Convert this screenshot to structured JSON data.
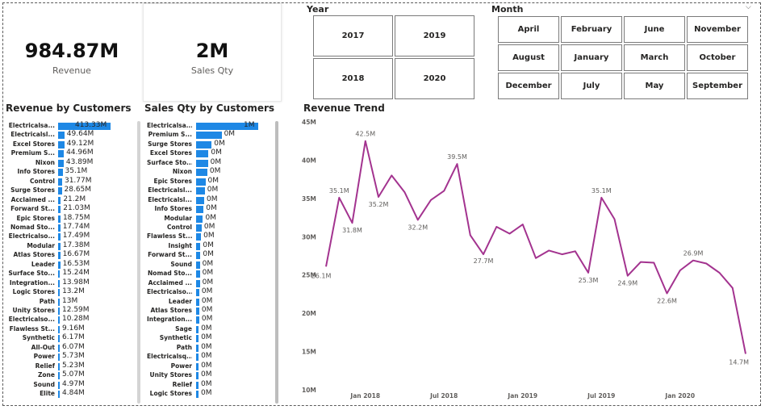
{
  "kpis": {
    "revenue": {
      "value": "984.87M",
      "label": "Revenue"
    },
    "sales_qty": {
      "value": "2M",
      "label": "Sales Qty"
    }
  },
  "year_slicer": {
    "title": "Year",
    "options": [
      "2017",
      "2019",
      "2018",
      "2020"
    ]
  },
  "month_slicer": {
    "title": "Month",
    "options": [
      "April",
      "February",
      "June",
      "November",
      "August",
      "January",
      "March",
      "October",
      "December",
      "July",
      "May",
      "September"
    ]
  },
  "revenue_by_customers": {
    "title": "Revenue by Customers",
    "rows": [
      {
        "name": "Electricalsa...",
        "value": 413.33,
        "label": "413.33M"
      },
      {
        "name": "Electricalsl...",
        "value": 49.64,
        "label": "49.64M"
      },
      {
        "name": "Excel Stores",
        "value": 49.12,
        "label": "49.12M"
      },
      {
        "name": "Premium S...",
        "value": 44.96,
        "label": "44.96M"
      },
      {
        "name": "Nixon",
        "value": 43.89,
        "label": "43.89M"
      },
      {
        "name": "Info Stores",
        "value": 35.1,
        "label": "35.1M"
      },
      {
        "name": "Control",
        "value": 31.77,
        "label": "31.77M"
      },
      {
        "name": "Surge Stores",
        "value": 28.65,
        "label": "28.65M"
      },
      {
        "name": "Acclaimed ...",
        "value": 21.2,
        "label": "21.2M"
      },
      {
        "name": "Forward St...",
        "value": 21.03,
        "label": "21.03M"
      },
      {
        "name": "Epic Stores",
        "value": 18.75,
        "label": "18.75M"
      },
      {
        "name": "Nomad Sto...",
        "value": 17.74,
        "label": "17.74M"
      },
      {
        "name": "Electricalso...",
        "value": 17.49,
        "label": "17.49M"
      },
      {
        "name": "Modular",
        "value": 17.38,
        "label": "17.38M"
      },
      {
        "name": "Atlas Stores",
        "value": 16.67,
        "label": "16.67M"
      },
      {
        "name": "Leader",
        "value": 16.53,
        "label": "16.53M"
      },
      {
        "name": "Surface Sto...",
        "value": 15.24,
        "label": "15.24M"
      },
      {
        "name": "Integration...",
        "value": 13.98,
        "label": "13.98M"
      },
      {
        "name": "Logic Stores",
        "value": 13.2,
        "label": "13.2M"
      },
      {
        "name": "Path",
        "value": 13.0,
        "label": "13M"
      },
      {
        "name": "Unity Stores",
        "value": 12.59,
        "label": "12.59M"
      },
      {
        "name": "Electricalso...",
        "value": 10.28,
        "label": "10.28M"
      },
      {
        "name": "Flawless St...",
        "value": 9.16,
        "label": "9.16M"
      },
      {
        "name": "Synthetic",
        "value": 6.17,
        "label": "6.17M"
      },
      {
        "name": "All-Out",
        "value": 6.07,
        "label": "6.07M"
      },
      {
        "name": "Power",
        "value": 5.73,
        "label": "5.73M"
      },
      {
        "name": "Relief",
        "value": 5.23,
        "label": "5.23M"
      },
      {
        "name": "Zone",
        "value": 5.07,
        "label": "5.07M"
      },
      {
        "name": "Sound",
        "value": 4.97,
        "label": "4.97M"
      },
      {
        "name": "Elite",
        "value": 4.84,
        "label": "4.84M"
      }
    ]
  },
  "sales_qty_by_customers": {
    "title": "Sales Qty by Customers",
    "rows": [
      {
        "name": "Electricalsa...",
        "value": 1.0,
        "label": "1M"
      },
      {
        "name": "Premium S...",
        "value": 0.41,
        "label": "0M"
      },
      {
        "name": "Surge Stores",
        "value": 0.25,
        "label": "0M"
      },
      {
        "name": "Excel Stores",
        "value": 0.2,
        "label": "0M"
      },
      {
        "name": "Surface Sto...",
        "value": 0.19,
        "label": "0M"
      },
      {
        "name": "Nixon",
        "value": 0.18,
        "label": "0M"
      },
      {
        "name": "Epic Stores",
        "value": 0.15,
        "label": "0M"
      },
      {
        "name": "Electricalsl...",
        "value": 0.14,
        "label": "0M"
      },
      {
        "name": "Electricalsl...",
        "value": 0.13,
        "label": "0M"
      },
      {
        "name": "Info Stores",
        "value": 0.12,
        "label": "0M"
      },
      {
        "name": "Modular",
        "value": 0.11,
        "label": "0M"
      },
      {
        "name": "Control",
        "value": 0.09,
        "label": "0M"
      },
      {
        "name": "Flawless St...",
        "value": 0.08,
        "label": "0M"
      },
      {
        "name": "Insight",
        "value": 0.07,
        "label": "0M"
      },
      {
        "name": "Forward St...",
        "value": 0.07,
        "label": "0M"
      },
      {
        "name": "Sound",
        "value": 0.06,
        "label": "0M"
      },
      {
        "name": "Nomad Sto...",
        "value": 0.06,
        "label": "0M"
      },
      {
        "name": "Acclaimed ...",
        "value": 0.06,
        "label": "0M"
      },
      {
        "name": "Electricalso...",
        "value": 0.05,
        "label": "0M"
      },
      {
        "name": "Leader",
        "value": 0.05,
        "label": "0M"
      },
      {
        "name": "Atlas Stores",
        "value": 0.05,
        "label": "0M"
      },
      {
        "name": "Integration...",
        "value": 0.05,
        "label": "0M"
      },
      {
        "name": "Sage",
        "value": 0.04,
        "label": "0M"
      },
      {
        "name": "Synthetic",
        "value": 0.04,
        "label": "0M"
      },
      {
        "name": "Path",
        "value": 0.04,
        "label": "0M"
      },
      {
        "name": "Electricalsq...",
        "value": 0.04,
        "label": "0M"
      },
      {
        "name": "Power",
        "value": 0.04,
        "label": "0M"
      },
      {
        "name": "Unity Stores",
        "value": 0.03,
        "label": "0M"
      },
      {
        "name": "Relief",
        "value": 0.03,
        "label": "0M"
      },
      {
        "name": "Logic Stores",
        "value": 0.03,
        "label": "0M"
      }
    ]
  },
  "colors": {
    "bar": "#1e88e5",
    "line": "#a3338f",
    "selected_bar": "#1e88e5"
  },
  "chart_data": {
    "type": "line",
    "title": "Revenue Trend",
    "xlabel": "",
    "ylabel": "",
    "x": [
      "2017-10",
      "2017-11",
      "2017-12",
      "2018-01",
      "2018-02",
      "2018-03",
      "2018-04",
      "2018-05",
      "2018-06",
      "2018-07",
      "2018-08",
      "2018-09",
      "2018-10",
      "2018-11",
      "2018-12",
      "2019-01",
      "2019-02",
      "2019-03",
      "2019-04",
      "2019-05",
      "2019-06",
      "2019-07",
      "2019-08",
      "2019-09",
      "2019-10",
      "2019-11",
      "2019-12",
      "2020-01",
      "2020-02",
      "2020-03",
      "2020-04",
      "2020-05",
      "2020-06"
    ],
    "series": [
      {
        "values": [
          26.1,
          35.1,
          31.8,
          42.5,
          35.2,
          38.0,
          35.8,
          32.2,
          34.8,
          36.0,
          39.5,
          30.2,
          27.7,
          31.3,
          30.4,
          31.6,
          27.2,
          28.2,
          27.7,
          28.1,
          25.3,
          35.1,
          32.3,
          24.9,
          26.7,
          26.6,
          22.6,
          25.6,
          26.9,
          26.5,
          25.3,
          23.3,
          14.7
        ]
      }
    ],
    "data_labels": [
      {
        "index": 0,
        "text": "26.1M"
      },
      {
        "index": 1,
        "text": "35.1M"
      },
      {
        "index": 2,
        "text": "31.8M"
      },
      {
        "index": 3,
        "text": "42.5M"
      },
      {
        "index": 4,
        "text": "35.2M"
      },
      {
        "index": 7,
        "text": "32.2M"
      },
      {
        "index": 10,
        "text": "39.5M"
      },
      {
        "index": 12,
        "text": "27.7M"
      },
      {
        "index": 20,
        "text": "25.3M"
      },
      {
        "index": 21,
        "text": "35.1M"
      },
      {
        "index": 23,
        "text": "24.9M"
      },
      {
        "index": 26,
        "text": "22.6M"
      },
      {
        "index": 28,
        "text": "26.9M"
      },
      {
        "index": 32,
        "text": "14.7M"
      }
    ],
    "ylim": [
      10,
      45
    ],
    "yticks": [
      10,
      15,
      20,
      25,
      30,
      35,
      40,
      45
    ],
    "ytick_labels": [
      "10M",
      "15M",
      "20M",
      "25M",
      "30M",
      "35M",
      "40M",
      "45M"
    ],
    "xticks": [
      {
        "at": "2018-01",
        "label": "Jan 2018"
      },
      {
        "at": "2018-07",
        "label": "Jul 2018"
      },
      {
        "at": "2019-01",
        "label": "Jan 2019"
      },
      {
        "at": "2019-07",
        "label": "Jul 2019"
      },
      {
        "at": "2020-01",
        "label": "Jan 2020"
      }
    ],
    "grid": false,
    "legend": "none"
  }
}
